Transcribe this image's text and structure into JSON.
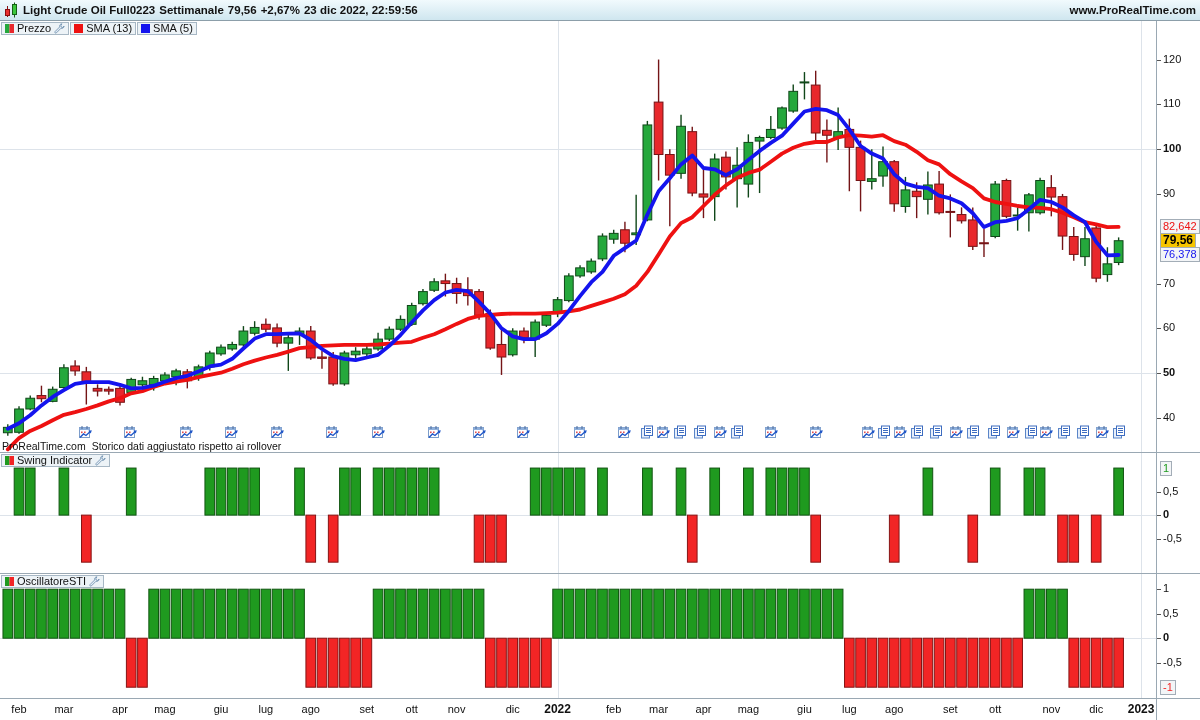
{
  "header": {
    "instrument": "Light Crude Oil Full0223",
    "period": "Settimanale",
    "price": "79,56",
    "change": "+2,67%",
    "datetime": "23 dic 2022, 22:59:56",
    "website": "www.ProRealTime.com"
  },
  "price_panel": {
    "source": "ProRealTime.com",
    "note": "Storico dati aggiustato rispetto ai rollover",
    "news_icons": [
      {
        "kind": "calendar"
      },
      {
        "kind": "calendar"
      },
      {
        "kind": "calendar"
      },
      {
        "kind": "calendar"
      },
      {
        "kind": "calendar"
      },
      {
        "kind": "calendar"
      },
      {
        "kind": "calendar"
      },
      {
        "kind": "calendar"
      },
      {
        "kind": "calendar"
      },
      {
        "kind": "calendar"
      },
      {
        "kind": "calendar"
      },
      {
        "kind": "calendar"
      },
      {
        "kind": "document"
      },
      {
        "kind": "calendar"
      },
      {
        "kind": "document"
      },
      {
        "kind": "document"
      },
      {
        "kind": "calendar"
      },
      {
        "kind": "document"
      },
      {
        "kind": "calendar"
      },
      {
        "kind": "calendar"
      },
      {
        "kind": "calendar"
      },
      {
        "kind": "document"
      },
      {
        "kind": "calendar"
      },
      {
        "kind": "document"
      },
      {
        "kind": "document"
      },
      {
        "kind": "calendar"
      },
      {
        "kind": "document"
      },
      {
        "kind": "document"
      },
      {
        "kind": "calendar"
      },
      {
        "kind": "document"
      },
      {
        "kind": "calendar"
      },
      {
        "kind": "document"
      },
      {
        "kind": "document"
      },
      {
        "kind": "calendar"
      },
      {
        "kind": "document"
      }
    ],
    "chart_data": {
      "type": "candlestick",
      "ylim": [
        32.4,
        128.6
      ],
      "legend": true,
      "yticks": [
        {
          "value": 120,
          "label": "120"
        },
        {
          "value": 110,
          "label": "110"
        },
        {
          "value": 100,
          "label": "100"
        },
        {
          "value": 90,
          "label": "90"
        },
        {
          "value": 70,
          "label": "70"
        },
        {
          "value": 60,
          "label": "60"
        },
        {
          "value": 50,
          "label": "50"
        },
        {
          "value": 40,
          "label": "40"
        }
      ],
      "ref_lines": [
        {
          "axis": "y",
          "value": 100
        },
        {
          "axis": "y",
          "value": 50
        }
      ],
      "ohlc": [
        [
          36.7,
          38.6,
          36.0,
          37.9
        ],
        [
          36.8,
          42.6,
          36.5,
          42.0
        ],
        [
          42.0,
          45.0,
          41.7,
          44.4
        ],
        [
          45.0,
          47.2,
          43.5,
          44.3
        ],
        [
          43.7,
          47.0,
          43.5,
          46.4
        ],
        [
          46.8,
          52.0,
          46.5,
          51.2
        ],
        [
          51.6,
          52.9,
          49.4,
          50.5
        ],
        [
          50.3,
          51.4,
          43.0,
          47.9
        ],
        [
          46.6,
          47.5,
          44.8,
          46.0
        ],
        [
          46.4,
          47.0,
          45.2,
          46.0
        ],
        [
          46.6,
          47.3,
          42.8,
          43.5
        ],
        [
          45.7,
          49.0,
          45.4,
          48.6
        ],
        [
          47.4,
          49.2,
          47.0,
          48.3
        ],
        [
          47.4,
          49.4,
          46.1,
          48.8
        ],
        [
          48.3,
          50.2,
          48.0,
          49.6
        ],
        [
          49.2,
          51.0,
          47.3,
          50.5
        ],
        [
          50.3,
          50.9,
          46.6,
          48.3
        ],
        [
          49.2,
          51.9,
          48.3,
          51.4
        ],
        [
          51.4,
          55.0,
          50.6,
          54.5
        ],
        [
          54.3,
          56.4,
          53.9,
          55.8
        ],
        [
          55.4,
          57.0,
          55.0,
          56.4
        ],
        [
          56.3,
          60.5,
          55.9,
          59.4
        ],
        [
          58.9,
          61.6,
          58.4,
          60.2
        ],
        [
          60.9,
          62.2,
          59.2,
          59.8
        ],
        [
          60.1,
          61.1,
          55.8,
          56.7
        ],
        [
          56.7,
          58.8,
          50.5,
          57.9
        ],
        [
          58.7,
          60.2,
          56.3,
          59.4
        ],
        [
          59.4,
          60.5,
          53.0,
          53.4
        ],
        [
          53.6,
          55.0,
          51.0,
          53.3
        ],
        [
          53.6,
          54.7,
          47.2,
          47.6
        ],
        [
          47.6,
          55.0,
          47.2,
          54.5
        ],
        [
          54.1,
          55.8,
          53.2,
          54.9
        ],
        [
          54.3,
          56.2,
          53.6,
          55.4
        ],
        [
          55.4,
          59.0,
          55.0,
          57.6
        ],
        [
          57.6,
          60.4,
          57.2,
          59.8
        ],
        [
          59.8,
          62.9,
          59.4,
          62.0
        ],
        [
          60.9,
          65.7,
          60.5,
          65.1
        ],
        [
          65.5,
          68.8,
          65.1,
          68.2
        ],
        [
          68.5,
          71.2,
          68.1,
          70.4
        ],
        [
          70.6,
          72.2,
          67.1,
          70.0
        ],
        [
          70.0,
          71.3,
          65.5,
          67.8
        ],
        [
          68.6,
          71.4,
          65.1,
          67.3
        ],
        [
          68.2,
          68.8,
          61.9,
          62.9
        ],
        [
          63.3,
          64.2,
          55.2,
          55.6
        ],
        [
          56.4,
          60.2,
          49.6,
          53.6
        ],
        [
          54.1,
          60.0,
          53.7,
          59.4
        ],
        [
          59.4,
          60.2,
          56.7,
          57.9
        ],
        [
          57.6,
          62.0,
          53.6,
          61.4
        ],
        [
          60.7,
          63.5,
          60.3,
          62.9
        ],
        [
          63.3,
          67.0,
          62.5,
          66.4
        ],
        [
          66.2,
          72.3,
          65.8,
          71.7
        ],
        [
          71.7,
          74.1,
          71.3,
          73.5
        ],
        [
          72.6,
          75.6,
          72.2,
          75.0
        ],
        [
          75.5,
          81.2,
          75.0,
          80.6
        ],
        [
          79.9,
          82.0,
          78.9,
          81.2
        ],
        [
          82.0,
          83.8,
          77.0,
          79.0
        ],
        [
          80.9,
          89.8,
          78.6,
          81.3
        ],
        [
          84.2,
          106.3,
          83.9,
          105.4
        ],
        [
          110.5,
          120.0,
          93.0,
          98.8
        ],
        [
          98.8,
          100.0,
          82.8,
          94.2
        ],
        [
          94.6,
          107.7,
          93.4,
          105.1
        ],
        [
          103.9,
          105.0,
          89.5,
          90.2
        ],
        [
          90.0,
          95.8,
          84.6,
          89.3
        ],
        [
          89.4,
          99.0,
          84.0,
          97.8
        ],
        [
          98.2,
          99.5,
          91.0,
          93.8
        ],
        [
          93.4,
          100.4,
          87.0,
          96.4
        ],
        [
          92.2,
          103.3,
          89.2,
          101.5
        ],
        [
          101.8,
          103.0,
          90.2,
          102.6
        ],
        [
          102.6,
          107.4,
          102.2,
          104.4
        ],
        [
          104.7,
          109.5,
          104.3,
          109.2
        ],
        [
          108.5,
          114.4,
          108.1,
          112.9
        ],
        [
          114.9,
          117.2,
          111.1,
          115.0
        ],
        [
          114.3,
          117.5,
          101.9,
          103.6
        ],
        [
          104.2,
          106.6,
          97.0,
          103.1
        ],
        [
          102.6,
          109.3,
          99.8,
          103.9
        ],
        [
          104.4,
          106.8,
          90.6,
          100.4
        ],
        [
          100.4,
          101.9,
          86.1,
          93.0
        ],
        [
          92.8,
          100.0,
          91.0,
          93.4
        ],
        [
          94.0,
          100.6,
          91.6,
          97.2
        ],
        [
          97.2,
          97.6,
          86.0,
          87.8
        ],
        [
          87.2,
          93.8,
          85.8,
          90.9
        ],
        [
          90.6,
          92.6,
          84.6,
          89.4
        ],
        [
          88.8,
          95.0,
          85.4,
          92.0
        ],
        [
          92.2,
          95.1,
          85.4,
          85.8
        ],
        [
          86.1,
          89.9,
          80.3,
          86.0
        ],
        [
          85.4,
          87.0,
          83.4,
          84.0
        ],
        [
          84.2,
          87.0,
          77.5,
          78.3
        ],
        [
          79.1,
          82.2,
          75.9,
          79.0
        ],
        [
          80.5,
          92.9,
          80.1,
          92.2
        ],
        [
          93.0,
          93.4,
          84.6,
          85.0
        ],
        [
          85.1,
          87.0,
          81.8,
          85.3
        ],
        [
          85.8,
          90.2,
          81.6,
          89.8
        ],
        [
          85.8,
          93.6,
          85.4,
          93.0
        ],
        [
          91.4,
          94.2,
          85.0,
          89.3
        ],
        [
          89.4,
          90.0,
          77.5,
          80.6
        ],
        [
          80.5,
          82.6,
          75.1,
          76.5
        ],
        [
          76.0,
          82.6,
          73.9,
          80.0
        ],
        [
          82.4,
          83.0,
          70.3,
          71.2
        ],
        [
          72.0,
          78.1,
          70.4,
          74.4
        ],
        [
          74.7,
          80.3,
          74.1,
          79.56
        ]
      ],
      "series": [
        {
          "name": "Prezzo",
          "type": "candlestick"
        },
        {
          "name": "SMA (13)",
          "type": "line",
          "color": "#ee1111",
          "values": [
            33,
            35.5,
            37.1,
            38.2,
            39.5,
            40.7,
            41.3,
            42,
            42.8,
            43.7,
            44.4,
            45.5,
            46,
            46.9,
            47.7,
            48.1,
            48.5,
            49.1,
            49.6,
            50.1,
            51,
            52,
            52.8,
            53.5,
            54.1,
            54.8,
            55.6,
            55.8,
            56.1,
            56.2,
            56.3,
            56.3,
            56.3,
            56.4,
            56.6,
            56.8,
            57,
            57.9,
            58.7,
            59.8,
            61,
            62.1,
            62.8,
            63,
            63.2,
            63.3,
            63.3,
            63.3,
            63.4,
            63.5,
            63.8,
            64.2,
            65,
            65.8,
            66.6,
            67.6,
            69.5,
            72.6,
            76.5,
            80.5,
            83.5,
            84.8,
            87.3,
            89.8,
            91.9,
            93.6,
            94.7,
            95.4,
            97.2,
            99,
            100.3,
            101.2,
            101.6,
            101.6,
            102.6,
            103.1,
            103,
            102.8,
            103.1,
            101.8,
            101,
            99.4,
            97.5,
            96.6,
            94.4,
            92.8,
            91.3,
            89,
            88.2,
            87.8,
            87.3,
            87,
            86.9,
            86.6,
            85.8,
            84.8,
            83.7,
            83.2,
            82.6,
            82.642
          ]
        },
        {
          "name": "SMA (5)",
          "type": "line",
          "color": "#1414ee",
          "values": [
            37.6,
            38.8,
            40.6,
            42.8,
            44.7,
            46.2,
            47.6,
            48,
            48,
            48,
            47.4,
            46.6,
            46.7,
            47.2,
            48.1,
            48.9,
            49.4,
            50.4,
            51.5,
            51.9,
            53.2,
            55.5,
            57.7,
            58.7,
            58.7,
            58.8,
            58.9,
            57.4,
            55.4,
            53.8,
            53.2,
            52.9,
            53.5,
            54.1,
            56.1,
            58.5,
            61.3,
            64,
            66.3,
            68,
            68.6,
            68.3,
            65.9,
            63.3,
            60,
            58.2,
            57.6,
            57.6,
            58.9,
            61,
            63.9,
            67.2,
            70.3,
            72.6,
            76.2,
            77.9,
            79.6,
            85.4,
            90.6,
            93.5,
            96.6,
            98.6,
            95.8,
            95.5,
            94.2,
            95.5,
            97.6,
            99.6,
            101.4,
            103,
            105.7,
            108.4,
            109,
            108.7,
            107.6,
            104.4,
            100.7,
            99,
            97.9,
            94.4,
            92.3,
            91.6,
            91.3,
            89.6,
            89,
            87.9,
            85.7,
            82.6,
            83.7,
            84,
            84.6,
            86.6,
            88.7,
            88.2,
            87,
            85.2,
            83.7,
            79.3,
            76.3,
            76.378
          ]
        }
      ],
      "annotations": [
        "82,642",
        "79,56",
        "76,378"
      ]
    }
  },
  "swing_panel": {
    "chart_data": {
      "type": "bar",
      "ylim": [
        -1.23,
        1.32
      ],
      "legend": true,
      "yticks": [
        {
          "value": 0.5,
          "label": "0,5"
        },
        {
          "value": 0,
          "label": "0"
        },
        {
          "value": -0.5,
          "label": "-0,5"
        }
      ],
      "ref_lines": [
        {
          "axis": "y",
          "value": 0
        }
      ],
      "series": [
        {
          "name": "Swing Indicator",
          "values": [
            0,
            1,
            1,
            0,
            0,
            1,
            0,
            -1,
            0,
            0,
            0,
            1,
            0,
            0,
            0,
            0,
            0,
            0,
            1,
            1,
            1,
            1,
            1,
            0,
            0,
            0,
            1,
            -1,
            0,
            -1,
            1,
            1,
            0,
            1,
            1,
            1,
            1,
            1,
            1,
            0,
            0,
            0,
            -1,
            -1,
            -1,
            0,
            0,
            1,
            1,
            1,
            1,
            1,
            0,
            1,
            0,
            0,
            0,
            1,
            0,
            0,
            1,
            -1,
            0,
            1,
            0,
            0,
            1,
            0,
            1,
            1,
            1,
            1,
            -1,
            0,
            0,
            0,
            0,
            0,
            0,
            -1,
            0,
            0,
            1,
            0,
            0,
            0,
            -1,
            0,
            1,
            0,
            0,
            1,
            1,
            0,
            -1,
            -1,
            0,
            -1,
            0,
            1
          ]
        }
      ],
      "annotations": [
        "1"
      ]
    }
  },
  "oscillator_panel": {
    "chart_data": {
      "type": "bar",
      "ylim": [
        -1.22,
        1.31
      ],
      "legend": true,
      "categories": [
        null,
        "feb",
        null,
        null,
        null,
        "mar",
        null,
        null,
        null,
        null,
        "apr",
        null,
        null,
        null,
        "mag",
        null,
        null,
        null,
        null,
        "giu",
        null,
        null,
        null,
        "lug",
        null,
        null,
        null,
        "ago",
        null,
        null,
        null,
        null,
        "set",
        null,
        null,
        null,
        "ott",
        null,
        null,
        null,
        "nov",
        null,
        null,
        null,
        null,
        "dic",
        null,
        null,
        null,
        "2022",
        null,
        null,
        null,
        null,
        "feb",
        null,
        null,
        null,
        "mar",
        null,
        null,
        null,
        "apr",
        null,
        null,
        null,
        "mag",
        null,
        null,
        null,
        null,
        "giu",
        null,
        null,
        null,
        "lug",
        null,
        null,
        null,
        "ago",
        null,
        null,
        null,
        null,
        "set",
        null,
        null,
        null,
        "ott",
        null,
        null,
        null,
        null,
        "nov",
        null,
        null,
        null,
        "dic",
        null,
        null,
        null,
        "2023"
      ],
      "yticks": [
        {
          "value": 1,
          "label": "1"
        },
        {
          "value": 0.5,
          "label": "0,5"
        },
        {
          "value": 0,
          "label": "0"
        },
        {
          "value": -0.5,
          "label": "-0,5"
        }
      ],
      "ref_lines": [
        {
          "axis": "y",
          "value": 0
        }
      ],
      "series": [
        {
          "name": "OscillatoreSTI",
          "values": [
            1,
            1,
            1,
            1,
            1,
            1,
            1,
            1,
            1,
            1,
            1,
            -1,
            -1,
            1,
            1,
            1,
            1,
            1,
            1,
            1,
            1,
            1,
            1,
            1,
            1,
            1,
            1,
            -1,
            -1,
            -1,
            -1,
            -1,
            -1,
            1,
            1,
            1,
            1,
            1,
            1,
            1,
            1,
            1,
            1,
            -1,
            -1,
            -1,
            -1,
            -1,
            -1,
            1,
            1,
            1,
            1,
            1,
            1,
            1,
            1,
            1,
            1,
            1,
            1,
            1,
            1,
            1,
            1,
            1,
            1,
            1,
            1,
            1,
            1,
            1,
            1,
            1,
            1,
            -1,
            -1,
            -1,
            -1,
            -1,
            -1,
            -1,
            -1,
            -1,
            -1,
            -1,
            -1,
            -1,
            -1,
            -1,
            -1,
            1,
            1,
            1,
            1,
            -1,
            -1,
            -1,
            -1,
            -1,
            null,
            null
          ]
        }
      ],
      "annotations": [
        "-1"
      ]
    }
  }
}
